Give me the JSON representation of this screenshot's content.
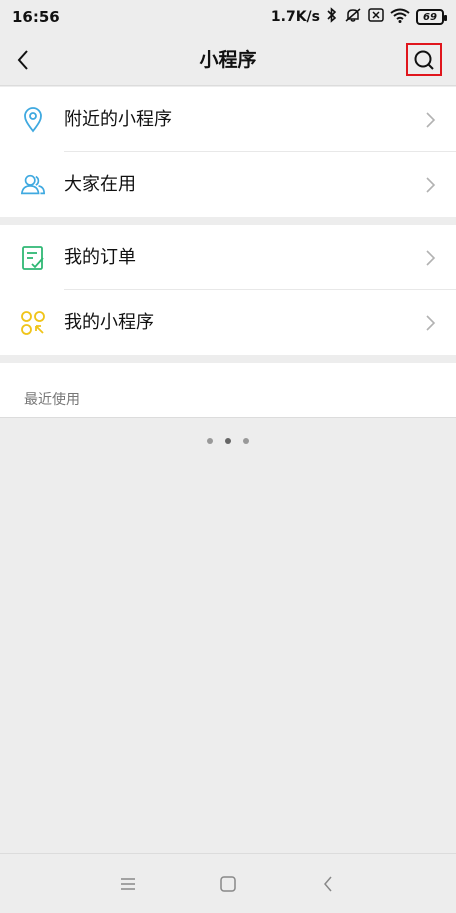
{
  "status_bar": {
    "time": "16:56",
    "network_speed": "1.7K/s",
    "battery": "69",
    "icons": [
      "bluetooth-icon",
      "notifications-off-icon",
      "sim-icon",
      "wifi-icon",
      "battery-icon"
    ]
  },
  "header": {
    "title": "小程序",
    "back_icon": "back-arrow-icon",
    "search_icon": "search-icon"
  },
  "menu_groups": [
    {
      "items": [
        {
          "label": "附近的小程序",
          "icon": "location-pin-icon"
        },
        {
          "label": "大家在用",
          "icon": "users-icon"
        }
      ]
    },
    {
      "items": [
        {
          "label": "我的订单",
          "icon": "order-list-icon"
        },
        {
          "label": "我的小程序",
          "icon": "mini-program-grid-icon"
        }
      ]
    }
  ],
  "recent": {
    "title": "最近使用"
  },
  "pager": {
    "count": 3,
    "active_index": 1
  },
  "bottom_nav": {
    "items": [
      "menu-icon",
      "home-icon",
      "back-icon"
    ]
  },
  "colors": {
    "background": "#ededed",
    "highlight_box": "#e0161d",
    "location_icon": "#3fa9e0",
    "users_icon": "#3fa9e0",
    "order_icon": "#2fb874",
    "grid_icon": "#f0c419"
  }
}
